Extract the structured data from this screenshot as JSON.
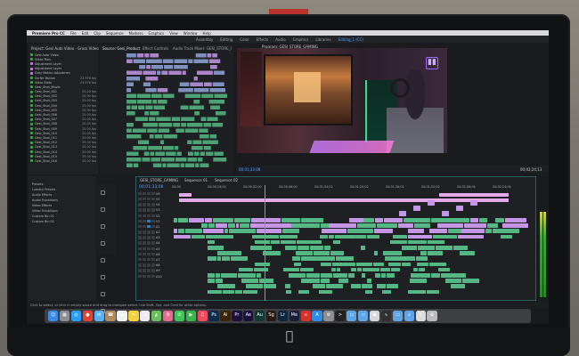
{
  "window": {
    "app_name": "Premiere Pro"
  },
  "menubar": {
    "items": [
      "Premiere Pro CC",
      "File",
      "Edit",
      "Clip",
      "Sequence",
      "Markers",
      "Graphics",
      "View",
      "Window",
      "Help"
    ]
  },
  "workspaces": {
    "items": [
      "Assembly",
      "Editing",
      "Color",
      "Effects",
      "Audio",
      "Graphics",
      "Libraries",
      "Editing_1 (CC)"
    ],
    "active_index": 7
  },
  "project_panel": {
    "title": "Project: Gesi Auto Video - Gross Video",
    "files": [
      {
        "name": "Gesi Auto Video",
        "rate": "",
        "color": "#3fa14b"
      },
      {
        "name": "Video Files",
        "rate": "",
        "color": "#3fa14b"
      },
      {
        "name": "Adjustment Layer",
        "rate": "",
        "color": "#c77dd8"
      },
      {
        "name": "Adjustment Layer",
        "rate": "",
        "color": "#c77dd8"
      },
      {
        "name": "Grey Motion Adjustment",
        "rate": "",
        "color": "#c77dd8"
      },
      {
        "name": "Surfer Motion",
        "rate": "23.976 fps",
        "color": "#3fa14b"
      },
      {
        "name": "Video Edits",
        "rate": "23.976 fps",
        "color": "#3fa14b"
      },
      {
        "name": "Gesi_Shot_Movie",
        "rate": "",
        "color": "#3fa14b"
      },
      {
        "name": "Gesi_Shot_001",
        "rate": "25.00 fps",
        "color": "#3fa14b"
      },
      {
        "name": "Gesi_Shot_002",
        "rate": "25.00 fps",
        "color": "#3fa14b"
      },
      {
        "name": "Gesi_Shot_003",
        "rate": "25.00 fps",
        "color": "#3fa14b"
      },
      {
        "name": "Gesi_Shot_004",
        "rate": "25.00 fps",
        "color": "#3fa14b"
      },
      {
        "name": "Gesi_Shot_005",
        "rate": "25.00 fps",
        "color": "#3fa14b"
      },
      {
        "name": "Gesi_Shot_006",
        "rate": "25.00 fps",
        "color": "#3fa14b"
      },
      {
        "name": "Gesi_Shot_007",
        "rate": "25.00 fps",
        "color": "#3fa14b"
      },
      {
        "name": "Gesi_Shot_008",
        "rate": "25.00 fps",
        "color": "#3fa14b"
      },
      {
        "name": "Gesi_Shot_009",
        "rate": "25.00 fps",
        "color": "#3fa14b"
      },
      {
        "name": "Gesi_Shot_010",
        "rate": "25.00 fps",
        "color": "#3fa14b"
      },
      {
        "name": "Gesi_Shot_011",
        "rate": "25.00 fps",
        "color": "#3fa14b"
      },
      {
        "name": "Gesi_Shot_012",
        "rate": "25.00 fps",
        "color": "#3fa14b"
      },
      {
        "name": "Gesi_Shot_013",
        "rate": "25.00 fps",
        "color": "#3fa14b"
      },
      {
        "name": "Gesi_Shot_014",
        "rate": "25.00 fps",
        "color": "#3fa14b"
      },
      {
        "name": "Gesi_Shot_015",
        "rate": "25.00 fps",
        "color": "#3fa14b"
      },
      {
        "name": "Gesi_Shot_016",
        "rate": "25.00 fps",
        "color": "#3fa14b"
      }
    ]
  },
  "source_panel": {
    "tabs": [
      "Source: Gesi_Product",
      "Effect Controls",
      "Audio Track Mixer: GESI_STORE_GAMING"
    ]
  },
  "program_monitor": {
    "title": "Program: GESI_STORE_GAMING",
    "timecode": "00;01;33;08",
    "duration": "00;02;24;13",
    "overlay_logo_icon": "twitch-icon"
  },
  "effects_panel": {
    "items": [
      "Presets",
      "Lumetri Presets",
      "Audio Effects",
      "Audio Transitions",
      "Video Effects",
      "Video Transitions",
      "Custom Bin 01",
      "Custom Bin 02"
    ]
  },
  "timeline": {
    "tabs": [
      "GESI_STORE_GAMING",
      "Sequence 01",
      "Sequence 02"
    ],
    "timecode": "00;01;33;08",
    "ruler": [
      "00;00",
      "00;00;16;00",
      "00;00;32;00",
      "00;00;48;00",
      "00;01;04;02",
      "00;01;20;02",
      "00;01;36;02",
      "00;01;52;02",
      "00;02;08;04",
      "00;02;24;04"
    ],
    "playhead_fraction": 0.255,
    "tracks": [
      "V6",
      "V5",
      "V4",
      "V3",
      "V2",
      "V1",
      "A1",
      "A2",
      "A3",
      "A4",
      "A5",
      "A6",
      "A7",
      "A8",
      "A9",
      "A10"
    ]
  },
  "statusbar": {
    "text": "Click to select, or click in empty space and drag to marquee select. Use Shift, Opt, and Cmd for other options."
  },
  "dock": {
    "icons": [
      {
        "name": "finder-icon",
        "color": "#3b8be8",
        "glyph": "☺"
      },
      {
        "name": "launchpad-icon",
        "color": "#8c8c96",
        "glyph": "▦"
      },
      {
        "name": "safari-icon",
        "color": "#2a9df4",
        "glyph": "◎"
      },
      {
        "name": "chrome-icon",
        "color": "#e34133",
        "glyph": "●"
      },
      {
        "name": "mail-icon",
        "color": "#5ab0f0",
        "glyph": "✉"
      },
      {
        "name": "contacts-icon",
        "color": "#b38a5c",
        "glyph": "☎"
      },
      {
        "name": "calendar-icon",
        "color": "#f2f2f2",
        "glyph": "▤"
      },
      {
        "name": "notes-icon",
        "color": "#f5d23c",
        "glyph": "✎"
      },
      {
        "name": "reminders-icon",
        "color": "#ececec",
        "glyph": "☰"
      },
      {
        "name": "maps-icon",
        "color": "#6bbf5a",
        "glyph": "◭"
      },
      {
        "name": "photos-icon",
        "color": "#e86a8e",
        "glyph": "✿"
      },
      {
        "name": "messages-icon",
        "color": "#3fc55a",
        "glyph": "✆"
      },
      {
        "name": "facetime-icon",
        "color": "#38b84a",
        "glyph": "▶"
      },
      {
        "name": "music-icon",
        "color": "#f04a5c",
        "glyph": "♫"
      },
      {
        "name": "photoshop-icon",
        "color": "#0d2d4e",
        "glyph": "Ps"
      },
      {
        "name": "illustrator-icon",
        "color": "#3a2607",
        "glyph": "Ai"
      },
      {
        "name": "premiere-icon",
        "color": "#1e0f3c",
        "glyph": "Pr"
      },
      {
        "name": "after-effects-icon",
        "color": "#1b1042",
        "glyph": "Ae"
      },
      {
        "name": "audition-icon",
        "color": "#0e3a34",
        "glyph": "Au"
      },
      {
        "name": "speedgrade-icon",
        "color": "#2a1a10",
        "glyph": "Sg"
      },
      {
        "name": "lightroom-icon",
        "color": "#0c2840",
        "glyph": "Lr"
      },
      {
        "name": "media-encoder-icon",
        "color": "#1a1e3c",
        "glyph": "Me"
      },
      {
        "name": "creative-cloud-icon",
        "color": "#d9322b",
        "glyph": "∞"
      },
      {
        "name": "app-store-icon",
        "color": "#2f8de6",
        "glyph": "A"
      },
      {
        "name": "system-preferences-icon",
        "color": "#8e8f96",
        "glyph": "⚙"
      },
      {
        "name": "terminal-icon",
        "color": "#222222",
        "glyph": ">"
      },
      {
        "name": "folder-icon",
        "color": "#5fa6e8",
        "glyph": "▭"
      },
      {
        "name": "folder-icon",
        "color": "#5fa6e8",
        "glyph": "▭"
      },
      {
        "name": "preview-icon",
        "color": "#d6d6dc",
        "glyph": "▣"
      },
      {
        "name": "activity-monitor-icon",
        "color": "#303030",
        "glyph": "∿"
      },
      {
        "name": "folder-icon",
        "color": "#5fa6e8",
        "glyph": "▭"
      },
      {
        "name": "downloads-icon",
        "color": "#5fa6e8",
        "glyph": "↓"
      },
      {
        "name": "documents-icon",
        "color": "#dcdcdc",
        "glyph": "▯"
      },
      {
        "name": "trash-icon",
        "color": "#b9b9c0",
        "glyph": "♻"
      }
    ]
  },
  "colors": {
    "accent_blue": "#4ea1ff",
    "clip_purple": "#c596e6",
    "clip_green": "#55b884",
    "clip_pink": "#e4a9e9"
  }
}
